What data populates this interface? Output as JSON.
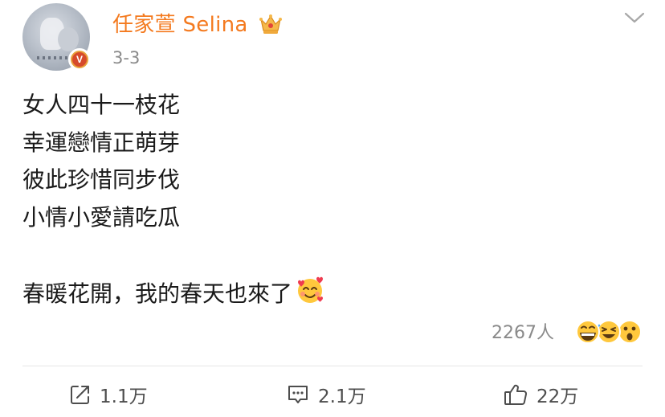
{
  "post": {
    "author": {
      "name": "任家萱 Selina",
      "verified_badge": "V",
      "name_color": "#f47a1f",
      "badge_color": "#d64a2b"
    },
    "timestamp": "3-3",
    "icons": {
      "menu": "chevron-down-icon",
      "member": "crown-icon",
      "inline_emoji": "smiling-face-with-hearts-icon",
      "reactions": [
        "grinning-face-icon",
        "laughing-face-icon",
        "surprised-face-icon"
      ]
    },
    "lines": [
      "女人四十一枝花",
      "幸運戀情正萌芽",
      "彼此珍惜同步伐",
      "小情小愛請吃瓜"
    ],
    "closing_line": "春暖花開，我的春天也來了",
    "reactions": {
      "count_label": "2267人"
    },
    "actions": {
      "share_count": "1.1万",
      "comment_count": "2.1万",
      "like_count": "22万"
    }
  }
}
